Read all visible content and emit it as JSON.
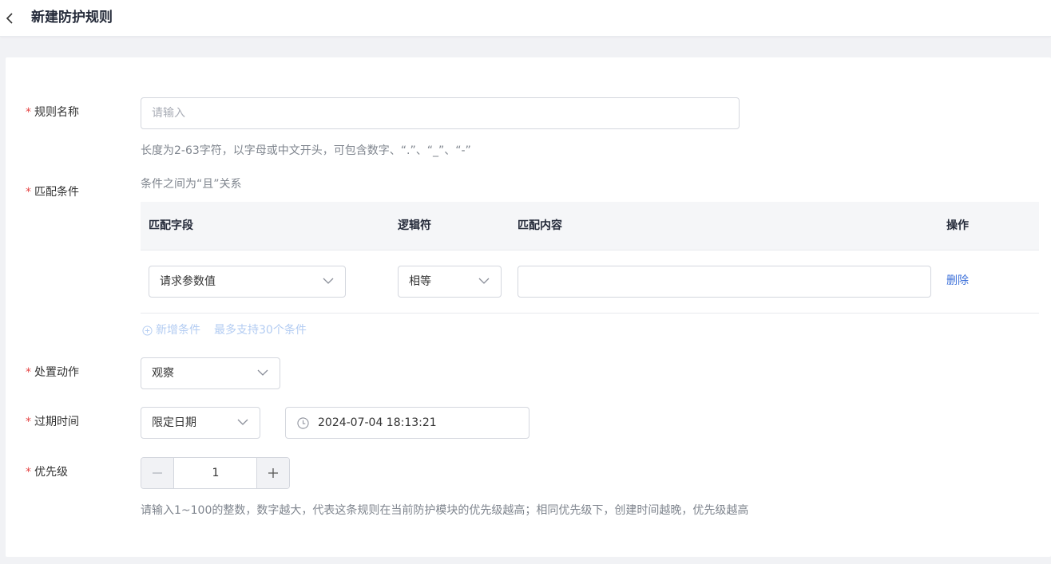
{
  "header": {
    "title": "新建防护规则"
  },
  "form": {
    "rule_name": {
      "label": "规则名称",
      "required_mark": "*",
      "placeholder": "请输入",
      "value": "",
      "hint": "长度为2-63字符，以字母或中文开头，可包含数字、“.”、“_”、“-”"
    },
    "conditions": {
      "label": "匹配条件",
      "required_mark": "*",
      "note": "条件之间为“且”关系",
      "columns": [
        "匹配字段",
        "逻辑符",
        "匹配内容",
        "操作"
      ],
      "rows": [
        {
          "field": "请求参数值",
          "operator": "相等",
          "content": "",
          "action": "删除"
        }
      ],
      "add_label": "新增条件",
      "limit_text": "最多支持30个条件"
    },
    "action": {
      "label": "处置动作",
      "required_mark": "*",
      "value": "观察"
    },
    "expiry": {
      "label": "过期时间",
      "required_mark": "*",
      "mode": "限定日期",
      "datetime": "2024-07-04 18:13:21"
    },
    "priority": {
      "label": "优先级",
      "required_mark": "*",
      "value": "1",
      "hint": "请输入1~100的整数，数字越大，代表这条规则在当前防护模块的优先级越高；相同优先级下，创建时间越晚，优先级越高"
    }
  },
  "icons": {
    "back": "chevron-left-icon",
    "dropdown": "chevron-down-icon",
    "add": "plus-circle-icon",
    "clock": "clock-icon",
    "minus": "minus-icon",
    "plus": "plus-icon"
  },
  "colors": {
    "required": "#e54545",
    "link": "#3b6fd9",
    "disabled_link": "#b3ccf2",
    "table_head_bg": "#f5f6f8"
  }
}
